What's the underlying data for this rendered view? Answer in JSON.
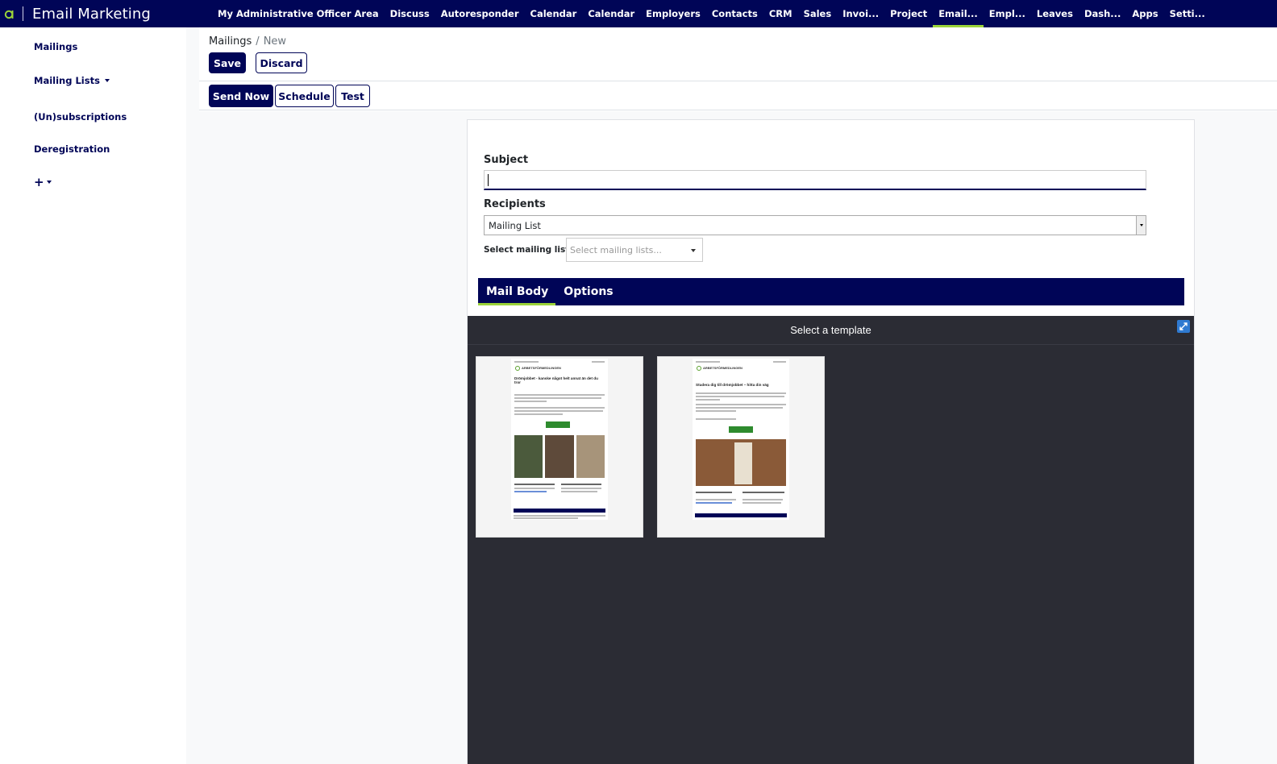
{
  "app": {
    "title": "Email Marketing"
  },
  "nav": {
    "items": [
      "My Administrative Officer Area",
      "Discuss",
      "Autoresponder",
      "Calendar",
      "Calendar",
      "Employers",
      "Contacts",
      "CRM",
      "Sales",
      "Invoi...",
      "Project",
      "Email...",
      "Empl...",
      "Leaves",
      "Dash...",
      "Apps",
      "Setti..."
    ],
    "active": "Email..."
  },
  "sidebar": {
    "items": [
      {
        "label": "Mailings"
      },
      {
        "label": "Mailing Lists"
      },
      {
        "label": "(Un)subscriptions"
      },
      {
        "label": "Deregistration"
      },
      {
        "label": "+"
      }
    ]
  },
  "breadcrumb": {
    "parent": "Mailings",
    "separator": "/",
    "current": "New"
  },
  "actions": {
    "save": "Save",
    "discard": "Discard"
  },
  "status_buttons": {
    "send_now": "Send Now",
    "schedule": "Schedule",
    "test": "Test"
  },
  "form": {
    "subject_label": "Subject",
    "subject_value": "",
    "recipients_label": "Recipients",
    "recipients_value": "Mailing List",
    "mailing_lists_label": "Select mailing lists:",
    "mailing_lists_placeholder": "Select mailing lists..."
  },
  "tabs": [
    {
      "label": "Mail Body",
      "active": true
    },
    {
      "label": "Options",
      "active": false
    }
  ],
  "template_picker": {
    "header": "Select a template",
    "templates": [
      {
        "logo": "ARBETSFÖRMEDLINGEN",
        "headline": "Drömjobbet - kanske något helt annat än det du tror"
      },
      {
        "logo": "ARBETSFÖRMEDLINGEN",
        "headline": "Studera dig till drömjobbet – hitta din väg"
      }
    ]
  },
  "colors": {
    "brand": "#000557",
    "accent": "#9bd33a",
    "template_bg": "#2b2c34",
    "expand_btn": "#2f7ad1"
  }
}
